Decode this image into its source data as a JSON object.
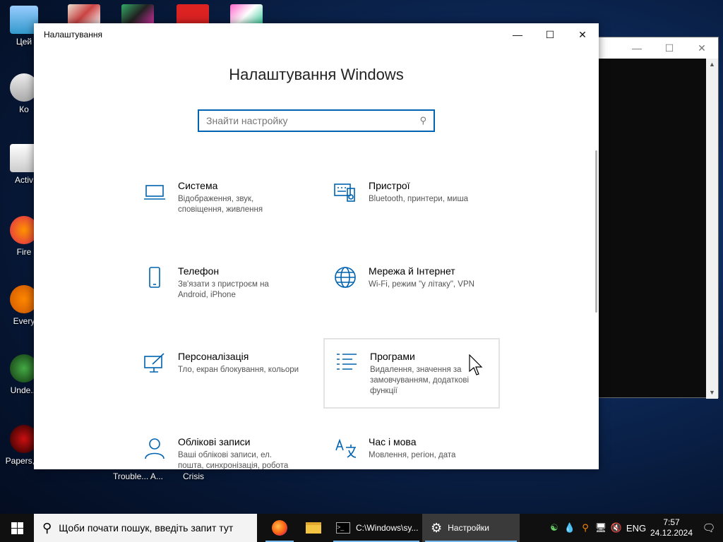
{
  "desktop": {
    "icons": [
      {
        "label": "Цей"
      },
      {
        "label": "Ко"
      },
      {
        "label": "Activ"
      },
      {
        "label": "Fire"
      },
      {
        "label": "Every"
      },
      {
        "label": "Unde..."
      },
      {
        "label": "Papers, P"
      }
    ],
    "captions": [
      "Trouble... A...",
      "Crisis"
    ]
  },
  "settings_window": {
    "title": "Налаштування",
    "heading": "Налаштування Windows",
    "search": {
      "placeholder": "Знайти настройку"
    },
    "tiles": [
      {
        "icon": "laptop-icon",
        "name": "Система",
        "desc": "Відображення, звук, сповіщення, живлення"
      },
      {
        "icon": "keyboard-devices-icon",
        "name": "Пристрої",
        "desc": "Bluetooth, принтери, миша"
      },
      {
        "icon": "phone-icon",
        "name": "Телефон",
        "desc": "Зв'язати з пристроєм на Android, iPhone"
      },
      {
        "icon": "globe-icon",
        "name": "Мережа й Інтернет",
        "desc": "Wi-Fi, режим \"у літаку\", VPN"
      },
      {
        "icon": "paint-icon",
        "name": "Персоналізація",
        "desc": "Тло, екран блокування, кольори"
      },
      {
        "icon": "apps-list-icon",
        "name": "Програми",
        "desc": "Видалення, значення за замовчуванням, додаткові функції"
      },
      {
        "icon": "person-icon",
        "name": "Облікові записи",
        "desc": "Ваші облікові записи, ел. пошта, синхронізація, робота"
      },
      {
        "icon": "time-language-icon",
        "name": "Час і мова",
        "desc": "Мовлення, регіон, дата"
      }
    ]
  },
  "taskbar": {
    "search_text": "Щоби почати пошук, введіть запит тут",
    "apps": [
      {
        "icon": "firefox-icon",
        "label": ""
      },
      {
        "icon": "folder-icon",
        "label": ""
      },
      {
        "icon": "console-icon",
        "label": "C:\\Windows\\sy..."
      },
      {
        "icon": "gear-icon",
        "label": "Настройки"
      }
    ],
    "language": "ENG",
    "time": "7:57",
    "date": "24.12.2024"
  },
  "colors": {
    "accent": "#0063b1",
    "taskbar": "#101010"
  }
}
